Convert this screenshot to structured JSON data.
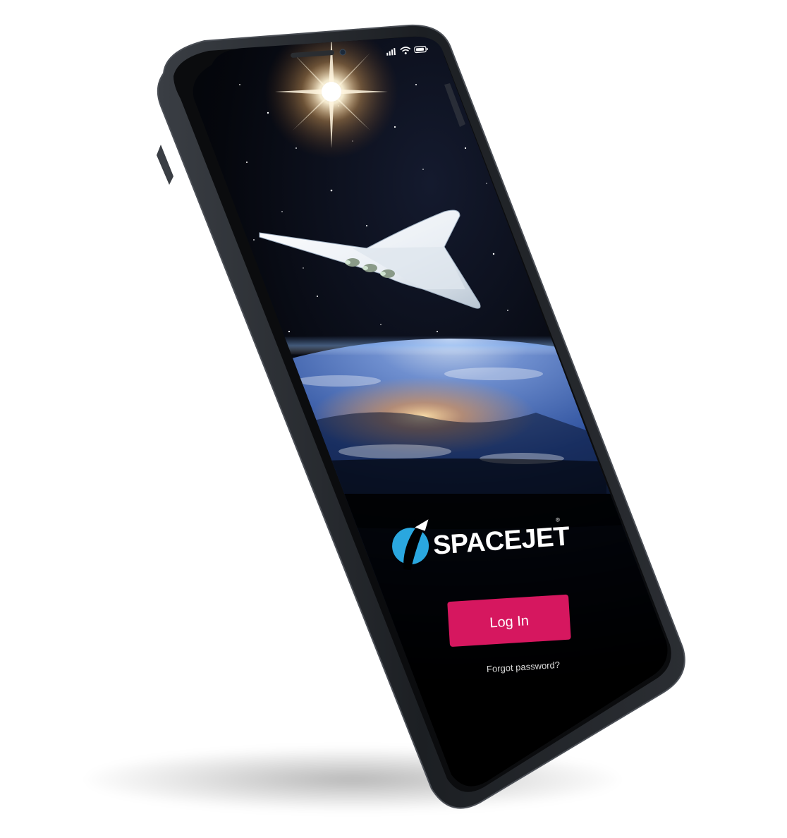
{
  "app": {
    "brand_name": "SPACEJET",
    "brand_mark": "®",
    "logo_icon": "rocket-swoosh-icon"
  },
  "login": {
    "button_label": "Log In",
    "forgot_password_label": "Forgot password?"
  },
  "status_bar": {
    "icons": [
      "signal-bars-icon",
      "wifi-icon",
      "battery-icon"
    ]
  },
  "hero": {
    "image": "spaceplane-over-earth-illustration"
  },
  "colors": {
    "accent": "#d6175f",
    "logo_blue": "#2aa7df",
    "phone_body": "#25282d",
    "screen_bg": "#000000"
  }
}
